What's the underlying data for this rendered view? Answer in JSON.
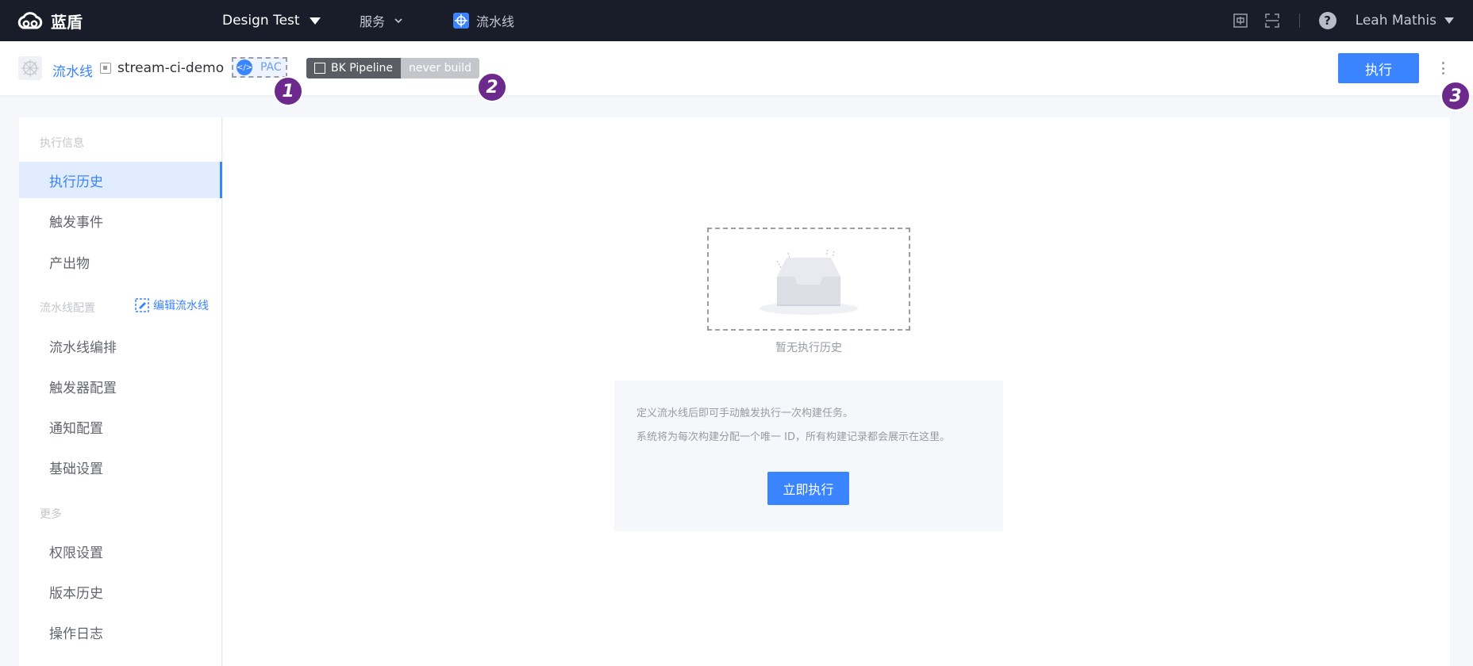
{
  "topnav": {
    "brand": "蓝盾",
    "project": "Design Test",
    "services": "服务",
    "pipeline": "流水线",
    "user": "Leah Mathis",
    "help": "?"
  },
  "header": {
    "crumb_link": "流水线",
    "pipeline_name": "stream-ci-demo",
    "pac_label": "PAC",
    "badge_left": "BK Pipeline",
    "badge_right": "never build",
    "execute_label": "执行"
  },
  "markers": [
    "1",
    "2",
    "3"
  ],
  "sidebar": {
    "group_exec": "执行信息",
    "items_exec": [
      "执行历史",
      "触发事件",
      "产出物"
    ],
    "group_config": "流水线配置",
    "edit_link": "编辑流水线",
    "items_config": [
      "流水线编排",
      "触发器配置",
      "通知配置",
      "基础设置"
    ],
    "group_more": "更多",
    "items_more": [
      "权限设置",
      "版本历史",
      "操作日志"
    ]
  },
  "main": {
    "empty_text": "暂无执行历史",
    "info_line1": "定义流水线后即可手动触发执行一次构建任务。",
    "info_line2": "系统将为每次构建分配一个唯一 ID，所有构建记录都会展示在这里。",
    "run_label": "立即执行"
  },
  "colors": {
    "topnav_bg": "#191d29",
    "primary": "#3a84ff",
    "marker": "#6b2a8c",
    "badge_dark": "#5a5d63",
    "badge_light": "#c4c6cc"
  }
}
